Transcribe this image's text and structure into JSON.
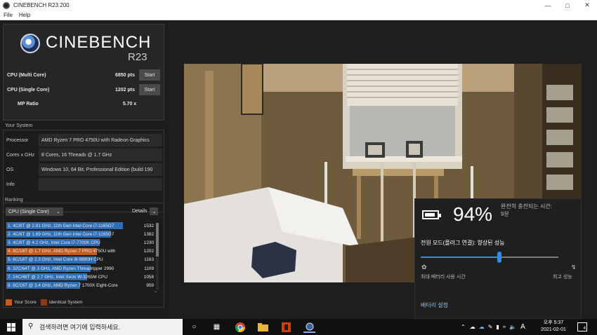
{
  "window": {
    "title": "CINEBENCH R23.200"
  },
  "menu": {
    "file": "File",
    "help": "Help"
  },
  "logo": {
    "name": "CINEBENCH",
    "version": "R23"
  },
  "scores": {
    "multi_label": "CPU (Multi Core)",
    "multi_value": "6850 pts",
    "start_label": "Start",
    "single_label": "CPU (Single Core)",
    "single_value": "1202 pts",
    "mp_label": "MP Ratio",
    "mp_value": "5.70 x"
  },
  "system": {
    "title": "Your System",
    "rows": [
      {
        "key": "Processor",
        "value": "AMD Ryzen 7 PRO 4750U with Radeon Graphics"
      },
      {
        "key": "Cores x GHz",
        "value": "8 Cores, 16 Threads @ 1.7 GHz"
      },
      {
        "key": "OS",
        "value": "Windows 10, 64 Bit, Professional Edition (build 190"
      },
      {
        "key": "Info",
        "value": ""
      }
    ]
  },
  "ranking": {
    "title": "Ranking",
    "selected_test": "CPU (Single Core)",
    "details_label": "Details",
    "items": [
      {
        "label": "1. 4C/8T @ 2.81 GHz, 11th Gen Intel Core i7-1165G7",
        "score": "1532",
        "kind": "blue",
        "fraction": 1.0
      },
      {
        "label": "2. 4C/8T @ 1.69 GHz, 11th Gen Intel Core i7-1165G7",
        "score": "1382",
        "kind": "blue",
        "fraction": 0.9
      },
      {
        "label": "3. 4C/8T @ 4.2 GHz, Intel Core i7-7700K CPU",
        "score": "1230",
        "kind": "blue",
        "fraction": 0.8
      },
      {
        "label": "4. 8C/16T @ 1.7 GHz, AMD Ryzen 7 PRO 4750U with",
        "score": "1202",
        "kind": "orange",
        "fraction": 0.78
      },
      {
        "label": "5. 8C/16T @ 2.3 GHz, Intel Core i9-9880H CPU",
        "score": "1183",
        "kind": "blue",
        "fraction": 0.77
      },
      {
        "label": "6. 32C/64T @ 3 GHz, AMD Ryzen Threadripper 2990",
        "score": "1109",
        "kind": "blue",
        "fraction": 0.72
      },
      {
        "label": "7. 24C/48T @ 2.7 GHz, Intel Xeon W-3265M CPU",
        "score": "1058",
        "kind": "blue",
        "fraction": 0.69
      },
      {
        "label": "8. 8C/16T @ 3.4 GHz, AMD Ryzen 7 1700X Eight-Core",
        "score": "959",
        "kind": "blue",
        "fraction": 0.63
      }
    ],
    "legend_your_score": "Your Score",
    "legend_identical": "Identical System"
  },
  "battery": {
    "percent": "94%",
    "full_charge_label": "완전히 충전되는 시간:",
    "full_charge_time": "9분",
    "power_mode": "전원 모드(플러그 연결): 향상된 성능",
    "slider_level": 0.57,
    "left_label": "최대 배터리 사용 시간",
    "right_label": "최고 성능",
    "settings_link": "배터리 설정"
  },
  "taskbar": {
    "search_placeholder": "검색하려면 여기에 입력하세요.",
    "time": "오후 5:37",
    "date": "2021-02-01",
    "ime": "A",
    "notifications": "4"
  },
  "colors": {
    "blue_bar": "#2f6db5",
    "orange_bar": "#c45a1c",
    "identical": "#8a3a12",
    "accent": "#2f8fe6"
  }
}
